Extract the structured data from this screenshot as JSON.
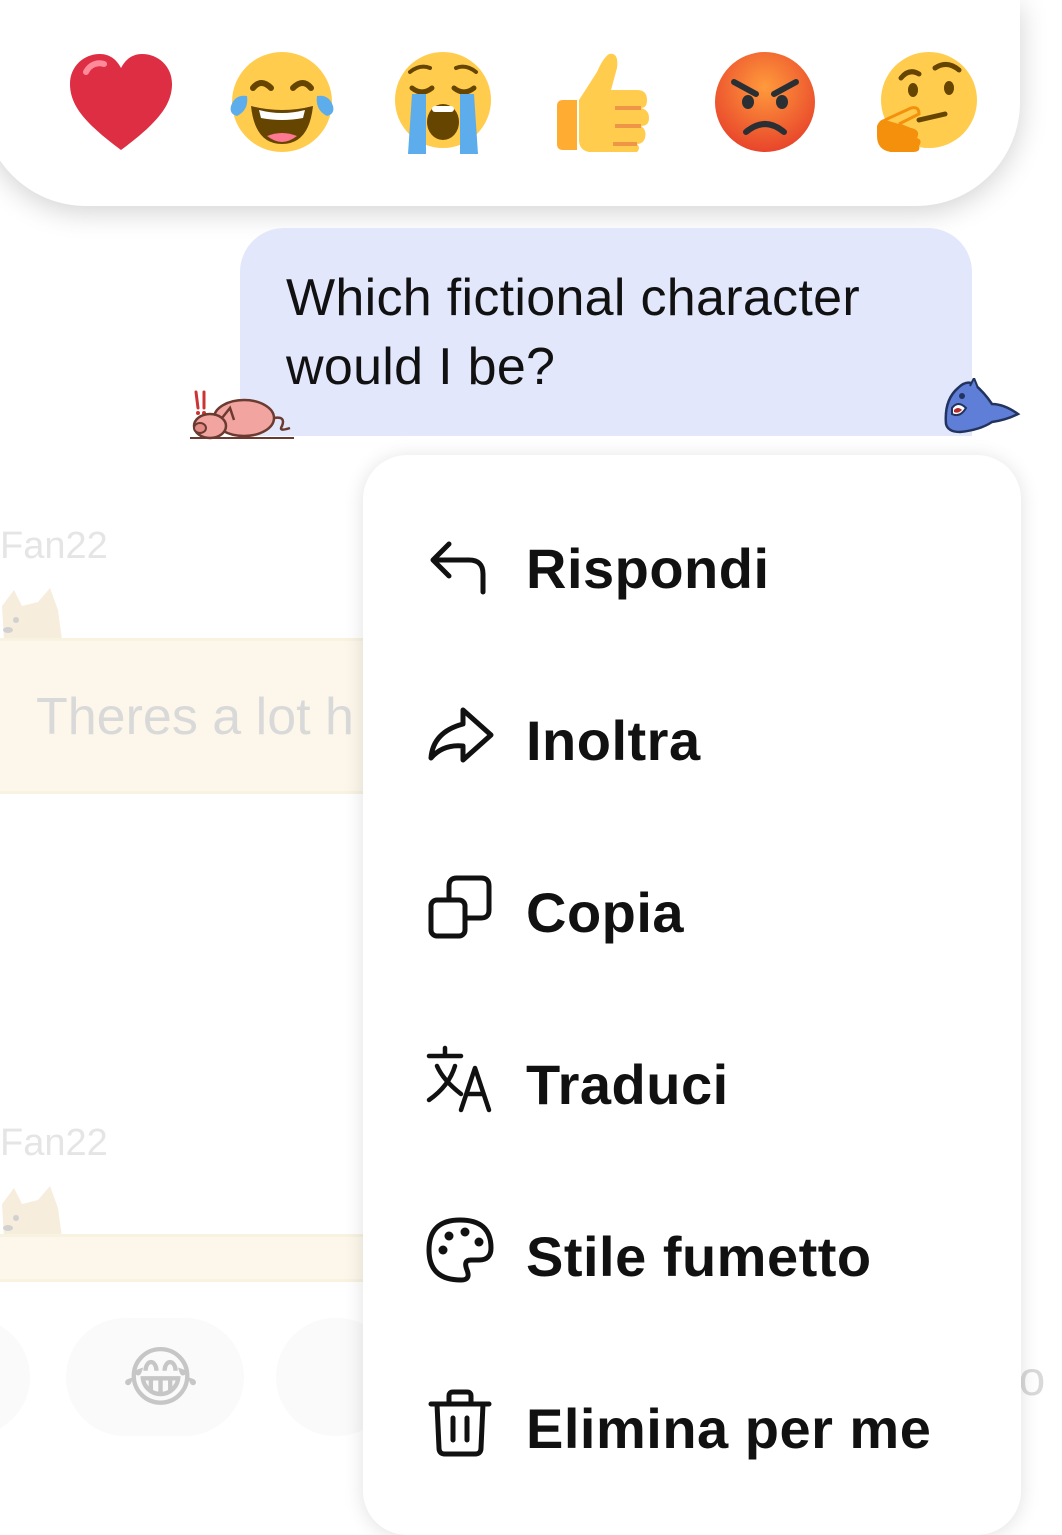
{
  "reactions": [
    {
      "name": "red-heart",
      "label": "❤️"
    },
    {
      "name": "face-with-tears-of-joy",
      "label": "😂"
    },
    {
      "name": "loudly-crying-face",
      "label": "😭"
    },
    {
      "name": "thumbs-up",
      "label": "👍"
    },
    {
      "name": "angry-face",
      "label": "😡"
    },
    {
      "name": "thinking-face",
      "label": "🤔"
    }
  ],
  "message": {
    "text": "Which fictional character would I be?",
    "bubble_color": "#e2e7fb",
    "sticker_left": "pig-sticker",
    "sticker_right": "shark-sticker"
  },
  "background_chat": {
    "messages": [
      {
        "username": "Fan22",
        "text": "Theres a lot h"
      },
      {
        "username": "Fan22",
        "text": ""
      }
    ],
    "quick_reaction_emoji": "😂",
    "side_text": "io"
  },
  "context_menu": {
    "items": [
      {
        "label": "Rispondi",
        "icon": "reply-icon"
      },
      {
        "label": "Inoltra",
        "icon": "forward-icon"
      },
      {
        "label": "Copia",
        "icon": "copy-icon"
      },
      {
        "label": "Traduci",
        "icon": "translate-icon"
      },
      {
        "label": "Stile fumetto",
        "icon": "palette-icon"
      },
      {
        "label": "Elimina per me",
        "icon": "trash-icon"
      }
    ]
  }
}
